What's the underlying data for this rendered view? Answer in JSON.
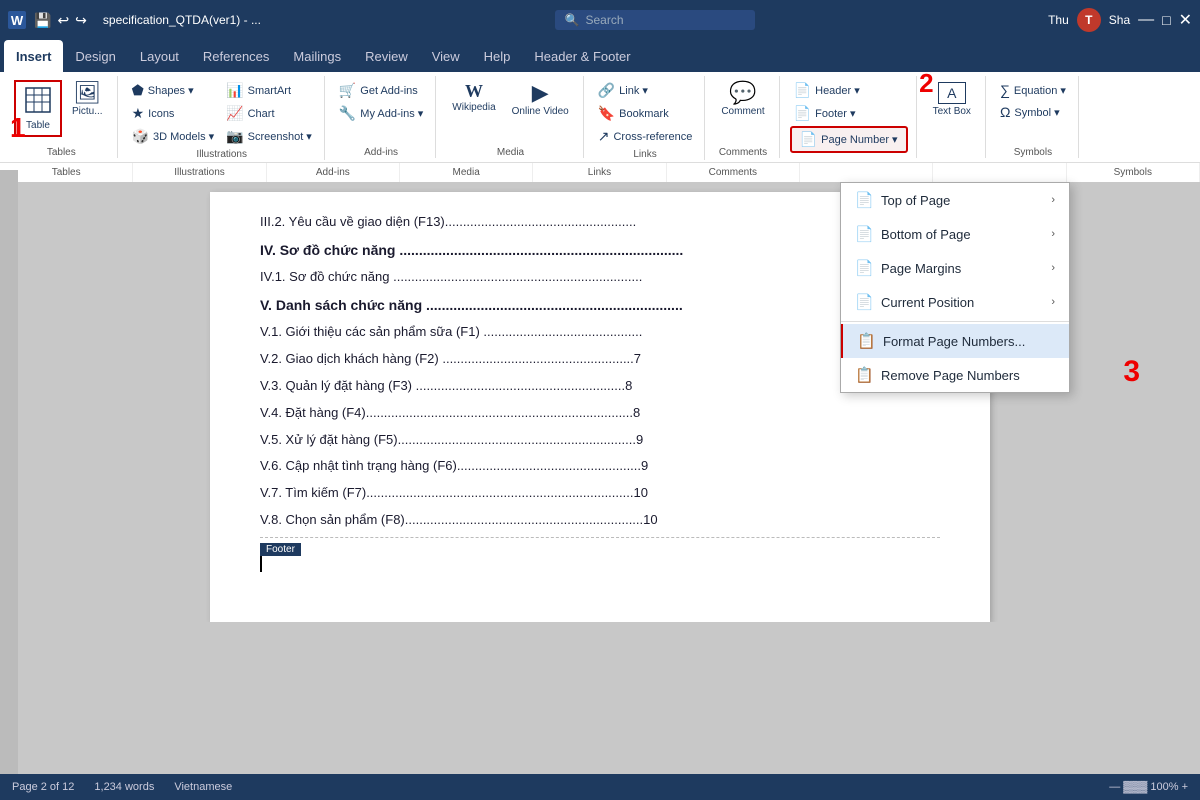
{
  "titlebar": {
    "icons": [
      "💾",
      "↩",
      "↪",
      "⬆"
    ],
    "filename": "specification_QTDA(ver1) - ...",
    "search_placeholder": "Search",
    "datetime": "Thu",
    "user_initial": "T",
    "share_label": "Sha"
  },
  "ribbon": {
    "tabs": [
      "Insert",
      "Design",
      "Layout",
      "References",
      "Mailings",
      "Review",
      "View",
      "Help",
      "Header & Footer"
    ],
    "active_tab": "Insert",
    "groups": {
      "tables": {
        "label": "Tables",
        "buttons": [
          {
            "id": "table",
            "icon": "⊞",
            "label": "Table"
          }
        ]
      },
      "illustrations": {
        "label": "Illustrations",
        "items": [
          "Shapes ▾",
          "Icons",
          "3D Models ▾",
          "SmartArt",
          "Chart",
          "Screenshot ▾"
        ]
      },
      "addins": {
        "label": "Add-ins",
        "items": [
          "Get Add-ins",
          "My Add-ins ▾"
        ]
      },
      "media": {
        "label": "Media",
        "items": [
          "Wikipedia",
          "Online Video"
        ]
      },
      "links": {
        "label": "Links",
        "items": [
          "Link ▾",
          "Bookmark",
          "Cross-reference"
        ]
      },
      "comments": {
        "label": "Comments",
        "items": [
          "Comment"
        ]
      },
      "header_footer": {
        "label": "",
        "items": [
          "Header ▾",
          "Footer ▾",
          "Page Number ▾"
        ]
      },
      "text": {
        "label": "",
        "items": [
          "Text Box",
          "A"
        ]
      },
      "symbols": {
        "label": "Symbols",
        "items": [
          "Equation ▾",
          "Symbol ▾"
        ]
      }
    }
  },
  "dropdown": {
    "items": [
      {
        "label": "Top of Page",
        "icon": "📄",
        "has_arrow": true
      },
      {
        "label": "Bottom of Page",
        "icon": "📄",
        "has_arrow": true
      },
      {
        "label": "Page Margins",
        "icon": "📄",
        "has_arrow": true
      },
      {
        "label": "Current Position",
        "icon": "📄",
        "has_arrow": true
      },
      {
        "label": "Format Page Numbers...",
        "icon": "📋",
        "highlighted": true
      },
      {
        "label": "Remove Page Numbers",
        "icon": "📋",
        "highlighted": false
      }
    ]
  },
  "document": {
    "lines": [
      {
        "text": "III.2. Yêu cầu về giao diện (F13).........................................................."
      },
      {
        "text": "IV. Sơ đồ chức năng .....................................................................",
        "bold": true
      },
      {
        "text": "IV.1. Sơ đồ chức năng ..................................................................."
      },
      {
        "text": "V. Danh sách chức năng ..................................................................",
        "bold": true
      },
      {
        "text": "V.1. Giới thiệu các sản phẩm sữa (F1) ............................................"
      },
      {
        "text": "V.2. Giao dịch khách hàng (F2) .....................................................7"
      },
      {
        "text": "V.3. Quản lý đặt hàng (F3) ..........................................................8"
      },
      {
        "text": "V.4. Đặt hàng (F4)..........................................................................8"
      },
      {
        "text": "V.5. Xử lý đặt hàng (F5)..................................................................9"
      },
      {
        "text": "V.6. Cập nhật tình trạng hàng (F6)...................................................9"
      },
      {
        "text": "V.7. Tìm kiếm (F7)..........................................................................10"
      },
      {
        "text": "V.8. Chọn sản phẩm (F8)..................................................................10"
      }
    ],
    "footer_label": "Footer"
  },
  "annotations": {
    "a1": "1",
    "a2": "2",
    "a3": "3"
  },
  "statusbar": {
    "page": "Page 2 of 12",
    "words": "1,234 words",
    "lang": "Vietnamese"
  }
}
